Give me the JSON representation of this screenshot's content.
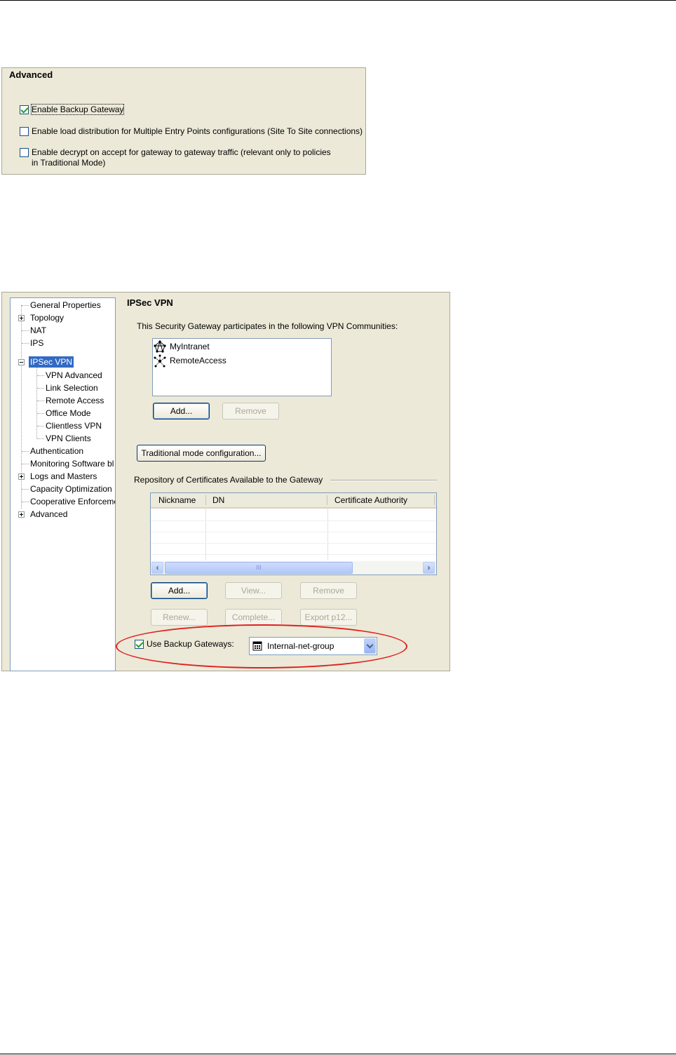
{
  "advanced": {
    "title": "Advanced",
    "options": [
      {
        "label": "Enable Backup Gateway",
        "checked": true
      },
      {
        "label": "Enable load distribution for Multiple Entry Points configurations (Site To Site connections)",
        "checked": false
      },
      {
        "label_line1": "Enable decrypt on accept for gateway to gateway traffic (relevant only to policies",
        "label_line2": "in Traditional Mode)",
        "checked": false
      }
    ]
  },
  "tree": {
    "items": [
      {
        "label": "General Properties"
      },
      {
        "label": "Topology",
        "expander": "plus"
      },
      {
        "label": "NAT"
      },
      {
        "label": "IPS"
      },
      {
        "label": "IPSec VPN",
        "expander": "minus",
        "selected": true
      },
      {
        "label": "VPN Advanced"
      },
      {
        "label": "Link Selection"
      },
      {
        "label": "Remote Access"
      },
      {
        "label": "Office Mode"
      },
      {
        "label": "Clientless VPN"
      },
      {
        "label": "VPN Clients"
      },
      {
        "label": "Authentication"
      },
      {
        "label": "Monitoring Software bl"
      },
      {
        "label": "Logs and Masters",
        "expander": "plus"
      },
      {
        "label": "Capacity Optimization"
      },
      {
        "label": "Cooperative Enforceme"
      },
      {
        "label": "Advanced",
        "expander": "plus"
      }
    ]
  },
  "ipsec": {
    "title": "IPSec VPN",
    "communities_label": "This Security Gateway participates in the following VPN Communities:",
    "communities": [
      {
        "label": "MyIntranet",
        "icon": "mesh-community-icon"
      },
      {
        "label": "RemoteAccess",
        "icon": "star-community-icon"
      }
    ],
    "add_label": "Add...",
    "remove_label": "Remove",
    "traditional_label": "Traditional mode configuration...",
    "repository_label": "Repository of Certificates Available to the Gateway",
    "columns": [
      "Nickname",
      "DN",
      "Certificate Authority"
    ],
    "scrollbar_grip": "III",
    "cert_buttons": {
      "add": "Add...",
      "view": "View...",
      "remove": "Remove",
      "renew": "Renew...",
      "complete": "Complete...",
      "export": "Export p12..."
    },
    "backup": {
      "label": "Use Backup Gateways:",
      "checked": true,
      "selected_value": "Internal-net-group"
    }
  },
  "colors": {
    "panel": "#ece9d8",
    "selection": "#316ac5",
    "highlight_ellipse": "#e02020"
  }
}
